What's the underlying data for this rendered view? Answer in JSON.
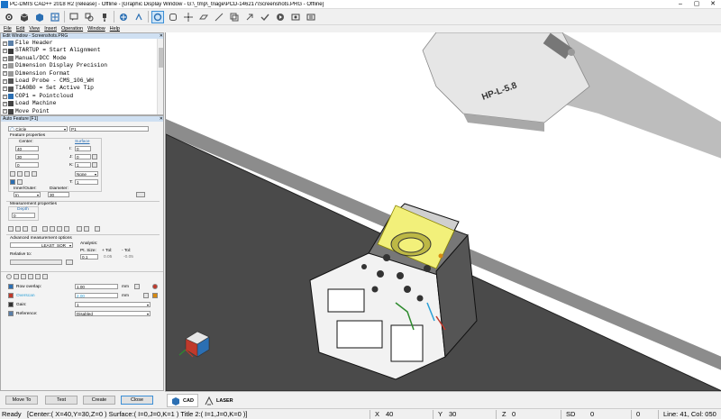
{
  "window": {
    "title": "PC-DMIS CAD++ 2018 R2 (release) - Offline - [Graphic Display Window - G:\\_tmp\\_triage\\PCD-146217\\Screenshots.PRG - Offline]"
  },
  "menu": [
    "File",
    "Edit",
    "View",
    "Insert",
    "Operation",
    "Window",
    "Help"
  ],
  "edit_window": {
    "title": "Edit Window - Screenshots.PRG",
    "items": [
      "File Header",
      "STARTUP = Start Alignment",
      "Manual/DCC Mode",
      "Dimension Display Precision",
      "Dimension Format",
      "Load Probe - CMS_106_WH",
      "T1A0B0 = Set Active Tip",
      "COP1 = Pointcloud",
      "Load Machine",
      "Move Point"
    ]
  },
  "auto_feature": {
    "title": "Auto Feature [F1]",
    "feature_type": "Circle",
    "feature_id": "P1",
    "feature_properties_label": "Feature properties",
    "center_label": "Center:",
    "surface_label": "Surface",
    "center": [
      "40",
      "30",
      "0"
    ],
    "ijk": [
      {
        "label": "I:",
        "value": "0"
      },
      {
        "label": "J:",
        "value": "0"
      },
      {
        "label": "K:",
        "value": "1"
      }
    ],
    "none_option": "None",
    "t_label": "T:",
    "t_value": "1",
    "inner_outer_label": "Inner/Outer:",
    "inner_outer": "In",
    "diameter_label": "Diameter:",
    "diameter": "30",
    "measurement_properties_label": "Measurement properties",
    "depth_label": "Depth",
    "depth": "0",
    "advanced_label": "Advanced measurement options",
    "fit": "LEAST_SQR",
    "analysis_label": "Analysis:",
    "pt_size_label": "Pt. Size:",
    "pt_size": "0.1",
    "plus_tol_label": "+ Tol:",
    "plus_tol": "0.05",
    "minus_tol_label": "- Tol:",
    "minus_tol": "-0.05",
    "relative_to_label": "Relative to:",
    "relative_to": "",
    "row_overlap_label": "Row overlap:",
    "row_overlap": "1.00",
    "overscan_label": "Overscan",
    "overscan": "2.00",
    "gain_label": "Gain:",
    "gain": "1",
    "reference_label": "Reference:",
    "reference": "Disabled",
    "unit": "mm"
  },
  "buttons": {
    "move_to": "Move To",
    "test": "Test",
    "create": "Create",
    "close": "Close"
  },
  "viewport_tabs": {
    "cad": "CAD",
    "laser": "LASER"
  },
  "probe_label": "HP-L-5.8",
  "status": {
    "ready": "Ready",
    "info": "[Center:( X=40,Y=30,Z=0 )  Surface:( I=0,J=0,K=1 )  Title 2:( I=1,J=0,K=0 )]",
    "x_label": "X",
    "x": "40",
    "y_label": "Y",
    "y": "30",
    "z_label": "Z",
    "z": "0",
    "sd_label": "SD",
    "sd": "0",
    "extra": "0",
    "line_col": "Line: 41, Col: 050"
  },
  "colors": {
    "accent": "#1a73c8",
    "selection_face": "#f2f07a",
    "overscan_text": "#2a9fd6"
  }
}
